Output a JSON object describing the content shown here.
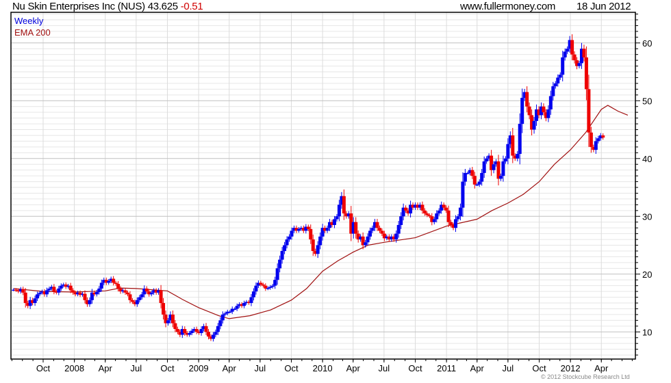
{
  "header": {
    "name": "Nu Skin Enterprises Inc (NUS)",
    "price": "43.625",
    "change": "-0.51",
    "site": "www.fullermoney.com",
    "date": "18 Jun 2012"
  },
  "footer": {
    "copyright": "© 2012 Stockcube Research Ltd"
  },
  "chart_data": {
    "type": "candlestick",
    "title": "Nu Skin Enterprises Inc (NUS) 43.625 -0.51",
    "legend": [
      {
        "label": "Weekly",
        "color": "#0000dd"
      },
      {
        "label": "EMA 200",
        "color": "#a01010"
      }
    ],
    "legend_placement": "top-left",
    "colors": {
      "up": "#0000ee",
      "down": "#ee0000",
      "ema": "#a01010",
      "grid_major": "#c0c0c0",
      "grid_minor": "#e6e6e6"
    },
    "grid": true,
    "ylim": [
      5.3,
      65.3
    ],
    "yticks": [
      10,
      20,
      30,
      40,
      50,
      60
    ],
    "y_axis_side": "right",
    "xlim": [
      "2007-07-02",
      "2012-06-25"
    ],
    "xticks": [
      {
        "label": "Oct",
        "date": "2007-10-01"
      },
      {
        "label": "2008",
        "date": "2008-01-01"
      },
      {
        "label": "Apr",
        "date": "2008-04-01"
      },
      {
        "label": "Jul",
        "date": "2008-07-01"
      },
      {
        "label": "Oct",
        "date": "2008-10-01"
      },
      {
        "label": "2009",
        "date": "2009-01-01"
      },
      {
        "label": "Apr",
        "date": "2009-04-01"
      },
      {
        "label": "Jul",
        "date": "2009-07-01"
      },
      {
        "label": "Oct",
        "date": "2009-10-01"
      },
      {
        "label": "2010",
        "date": "2010-01-01"
      },
      {
        "label": "Apr",
        "date": "2010-04-01"
      },
      {
        "label": "Jul",
        "date": "2010-07-01"
      },
      {
        "label": "Oct",
        "date": "2010-10-01"
      },
      {
        "label": "2011",
        "date": "2011-01-01"
      },
      {
        "label": "Apr",
        "date": "2011-04-01"
      },
      {
        "label": "Jul",
        "date": "2011-07-01"
      },
      {
        "label": "Oct",
        "date": "2011-10-01"
      },
      {
        "label": "2012",
        "date": "2012-01-01"
      },
      {
        "label": "Apr",
        "date": "2012-04-01"
      }
    ],
    "first_week": "2007-07-06",
    "weekly_close": [
      17.3,
      17.2,
      17.0,
      17.4,
      16.8,
      15.0,
      14.5,
      15.5,
      15.0,
      15.8,
      16.5,
      16.8,
      17.0,
      16.5,
      17.2,
      17.5,
      17.8,
      17.0,
      16.8,
      17.5,
      18.0,
      18.2,
      17.8,
      18.0,
      17.2,
      16.8,
      16.5,
      16.8,
      16.4,
      16.6,
      15.5,
      14.8,
      15.5,
      16.8,
      16.5,
      16.9,
      17.5,
      18.5,
      19.0,
      18.5,
      18.8,
      19.2,
      18.5,
      18.3,
      17.5,
      17.0,
      17.2,
      16.8,
      16.5,
      15.5,
      15.2,
      14.8,
      15.5,
      16.0,
      16.5,
      17.5,
      17.0,
      16.5,
      16.8,
      17.2,
      16.8,
      17.2,
      15.0,
      13.0,
      11.5,
      12.0,
      13.0,
      11.5,
      10.5,
      10.0,
      9.5,
      10.5,
      9.8,
      9.5,
      9.8,
      10.2,
      10.5,
      10.0,
      9.8,
      10.5,
      11.0,
      10.0,
      9.2,
      8.8,
      9.5,
      10.0,
      11.0,
      12.0,
      13.0,
      13.2,
      13.5,
      13.5,
      14.0,
      14.0,
      14.5,
      14.8,
      14.5,
      15.0,
      15.2,
      15.0,
      16.0,
      17.0,
      18.0,
      18.5,
      18.2,
      18.0,
      17.5,
      17.6,
      17.8,
      18.0,
      19.0,
      21.0,
      22.5,
      24.0,
      25.0,
      26.0,
      26.5,
      27.5,
      28.0,
      27.5,
      27.8,
      28.0,
      27.5,
      28.2,
      27.8,
      26.0,
      24.0,
      23.5,
      25.0,
      26.5,
      28.0,
      27.5,
      28.0,
      29.0,
      28.5,
      29.5,
      30.0,
      32.0,
      33.5,
      30.5,
      30.0,
      30.5,
      27.0,
      29.0,
      27.0,
      26.0,
      26.5,
      25.0,
      25.5,
      26.5,
      27.5,
      28.0,
      29.0,
      28.0,
      27.5,
      27.0,
      26.2,
      26.5,
      26.0,
      26.5,
      26.0,
      27.0,
      28.5,
      30.0,
      31.5,
      31.0,
      30.5,
      32.0,
      31.5,
      32.0,
      31.5,
      32.0,
      31.0,
      30.5,
      30.2,
      30.0,
      29.0,
      29.5,
      30.5,
      31.0,
      32.0,
      31.5,
      31.0,
      29.0,
      28.5,
      28.0,
      29.5,
      30.0,
      31.5,
      36.0,
      37.5,
      37.5,
      38.0,
      37.0,
      35.5,
      35.5,
      36.0,
      37.5,
      39.5,
      40.0,
      40.5,
      38.0,
      39.0,
      39.5,
      36.5,
      37.0,
      39.5,
      40.0,
      42.5,
      44.0,
      40.5,
      40.0,
      40.8,
      46.0,
      50.5,
      51.5,
      49.0,
      47.5,
      45.0,
      46.5,
      48.5,
      47.5,
      49.0,
      48.0,
      47.0,
      48.5,
      50.8,
      52.5,
      53.0,
      54.0,
      54.5,
      57.5,
      58.5,
      59.0,
      60.5,
      58.0,
      57.0,
      56.0,
      56.5,
      59.0,
      57.5,
      52.0,
      44.5,
      42.0,
      41.5,
      43.0,
      43.5,
      44.0,
      43.625
    ],
    "ema_200": [
      {
        "date": "2007-07-06",
        "value": 17.5
      },
      {
        "date": "2007-10-01",
        "value": 17.0
      },
      {
        "date": "2008-01-01",
        "value": 16.9
      },
      {
        "date": "2008-04-01",
        "value": 17.1
      },
      {
        "date": "2008-05-15",
        "value": 17.6
      },
      {
        "date": "2008-07-01",
        "value": 17.5
      },
      {
        "date": "2008-10-01",
        "value": 17.1
      },
      {
        "date": "2008-11-15",
        "value": 15.6
      },
      {
        "date": "2009-01-01",
        "value": 14.2
      },
      {
        "date": "2009-03-01",
        "value": 12.8
      },
      {
        "date": "2009-04-01",
        "value": 12.3
      },
      {
        "date": "2009-06-01",
        "value": 12.8
      },
      {
        "date": "2009-08-01",
        "value": 13.8
      },
      {
        "date": "2009-10-01",
        "value": 15.5
      },
      {
        "date": "2009-11-15",
        "value": 17.5
      },
      {
        "date": "2010-01-01",
        "value": 20.5
      },
      {
        "date": "2010-02-15",
        "value": 22.3
      },
      {
        "date": "2010-04-01",
        "value": 23.8
      },
      {
        "date": "2010-05-15",
        "value": 25.0
      },
      {
        "date": "2010-07-01",
        "value": 25.5
      },
      {
        "date": "2010-10-01",
        "value": 26.3
      },
      {
        "date": "2011-01-01",
        "value": 28.3
      },
      {
        "date": "2011-04-01",
        "value": 29.5
      },
      {
        "date": "2011-05-15",
        "value": 31.0
      },
      {
        "date": "2011-07-01",
        "value": 32.3
      },
      {
        "date": "2011-08-15",
        "value": 33.8
      },
      {
        "date": "2011-10-01",
        "value": 36.0
      },
      {
        "date": "2011-11-15",
        "value": 39.0
      },
      {
        "date": "2012-01-01",
        "value": 41.5
      },
      {
        "date": "2012-02-15",
        "value": 44.5
      },
      {
        "date": "2012-04-01",
        "value": 48.5
      },
      {
        "date": "2012-04-20",
        "value": 49.2
      },
      {
        "date": "2012-05-20",
        "value": 48.2
      },
      {
        "date": "2012-06-18",
        "value": 47.5
      }
    ]
  }
}
